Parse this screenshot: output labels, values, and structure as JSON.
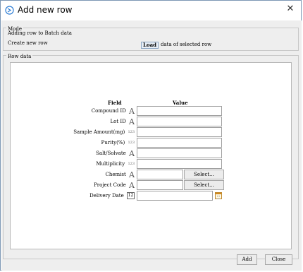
{
  "window": {
    "title": "Add new row",
    "close_glyph": "✕"
  },
  "mode": {
    "group_title": "Mode",
    "adding_text": "Adding row to Batch data",
    "create_new_label": "Create new row",
    "load_button_label": "Load",
    "load_suffix_text": "data of selected row"
  },
  "row_data": {
    "group_title": "Row data",
    "headers": {
      "field": "Field",
      "value": "Value"
    },
    "fields": [
      {
        "label": "Compound ID",
        "type_icon": "A",
        "value": ""
      },
      {
        "label": "Lot ID",
        "type_icon": "A",
        "value": ""
      },
      {
        "label": "Sample Amount(mg)",
        "type_icon": "123",
        "value": ""
      },
      {
        "label": "Purity(%)",
        "type_icon": "123",
        "value": ""
      },
      {
        "label": "Salt/Solvate",
        "type_icon": "A",
        "value": ""
      },
      {
        "label": "Multiplicity",
        "type_icon": "123",
        "value": ""
      },
      {
        "label": "Chemist",
        "type_icon": "A",
        "value": "",
        "button": "Select..."
      },
      {
        "label": "Project Code",
        "type_icon": "A",
        "value": "",
        "button": "Select..."
      },
      {
        "label": "Delivery Date",
        "type_icon": "12",
        "value": ""
      }
    ]
  },
  "footer": {
    "add_label": "Add",
    "close_label": "Close"
  }
}
